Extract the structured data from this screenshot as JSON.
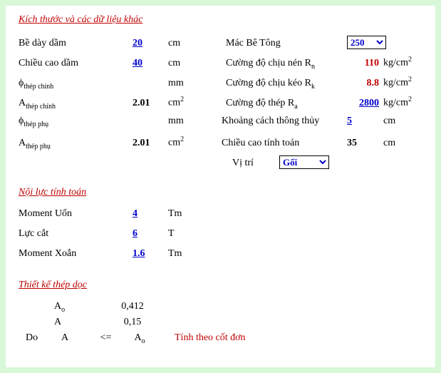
{
  "sections": {
    "dims_title": "Kích thước và các dữ liệu khác",
    "forces_title": "Nội lực tính toán",
    "design_title": "Thiết kế thép dọc"
  },
  "dims": {
    "be_day_dam_label": "Bề dày dầm",
    "be_day_dam_val": "20",
    "chieu_cao_dam_label": "Chiều cao dầm",
    "chieu_cao_dam_val": "40",
    "phi_thep_chinh_label_sym": "ϕ",
    "phi_thep_chinh_label_sub": "thép chính",
    "a_thep_chinh_label_sym": "A",
    "a_thep_chinh_label_sub": "thép chính",
    "a_thep_chinh_val": "2.01",
    "phi_thep_phu_label_sym": "ϕ",
    "phi_thep_phu_label_sub": "thép phụ",
    "a_thep_phu_label_sym": "A",
    "a_thep_phu_label_sub": "thép phụ",
    "a_thep_phu_val": "2.01",
    "unit_cm": "cm",
    "unit_mm": "mm",
    "unit_cm2_base": "cm",
    "unit_cm2_exp": "2"
  },
  "mat": {
    "mac_label": "Mác Bê Tông",
    "mac_sel": "250",
    "rn_label_pre": "Cường độ chịu nén R",
    "rn_label_sub": "n",
    "rn_val": "110",
    "rk_label_pre": "Cường độ chịu kéo R",
    "rk_label_sub": "k",
    "rk_val": "8.8",
    "ra_label_pre": "Cường độ thép R",
    "ra_label_sub": "a",
    "ra_val": "2800",
    "kc_label": "Khoảng cách thông thủy",
    "kc_val": "5",
    "cc_label": "Chiều cao tính toán",
    "cc_val": "35",
    "vitri_label": "Vị trí",
    "vitri_sel": "Gối",
    "unit_kgcm2_base": "kg/cm",
    "unit_kgcm2_exp": "2",
    "unit_cm": "cm"
  },
  "forces": {
    "moment_uon_label": "Moment Uốn",
    "moment_uon_val": "4",
    "moment_uon_unit": "Tm",
    "luc_cat_label": "Lực cắt",
    "luc_cat_val": "6",
    "luc_cat_unit": "T",
    "moment_xoan_label": "Moment Xoắn",
    "moment_xoan_val": "1.6",
    "moment_xoan_unit": "Tm"
  },
  "design": {
    "Ao_sym": "A",
    "Ao_sub": "o",
    "Ao_val": "0,412",
    "A_sym": "A",
    "A_val": "0,15",
    "cmp_do": "Do",
    "cmp_lhs": "A",
    "cmp_op": "<=",
    "cmp_rhs_sym": "A",
    "cmp_rhs_sub": "o",
    "cmp_note": "Tính theo cốt đơn"
  }
}
